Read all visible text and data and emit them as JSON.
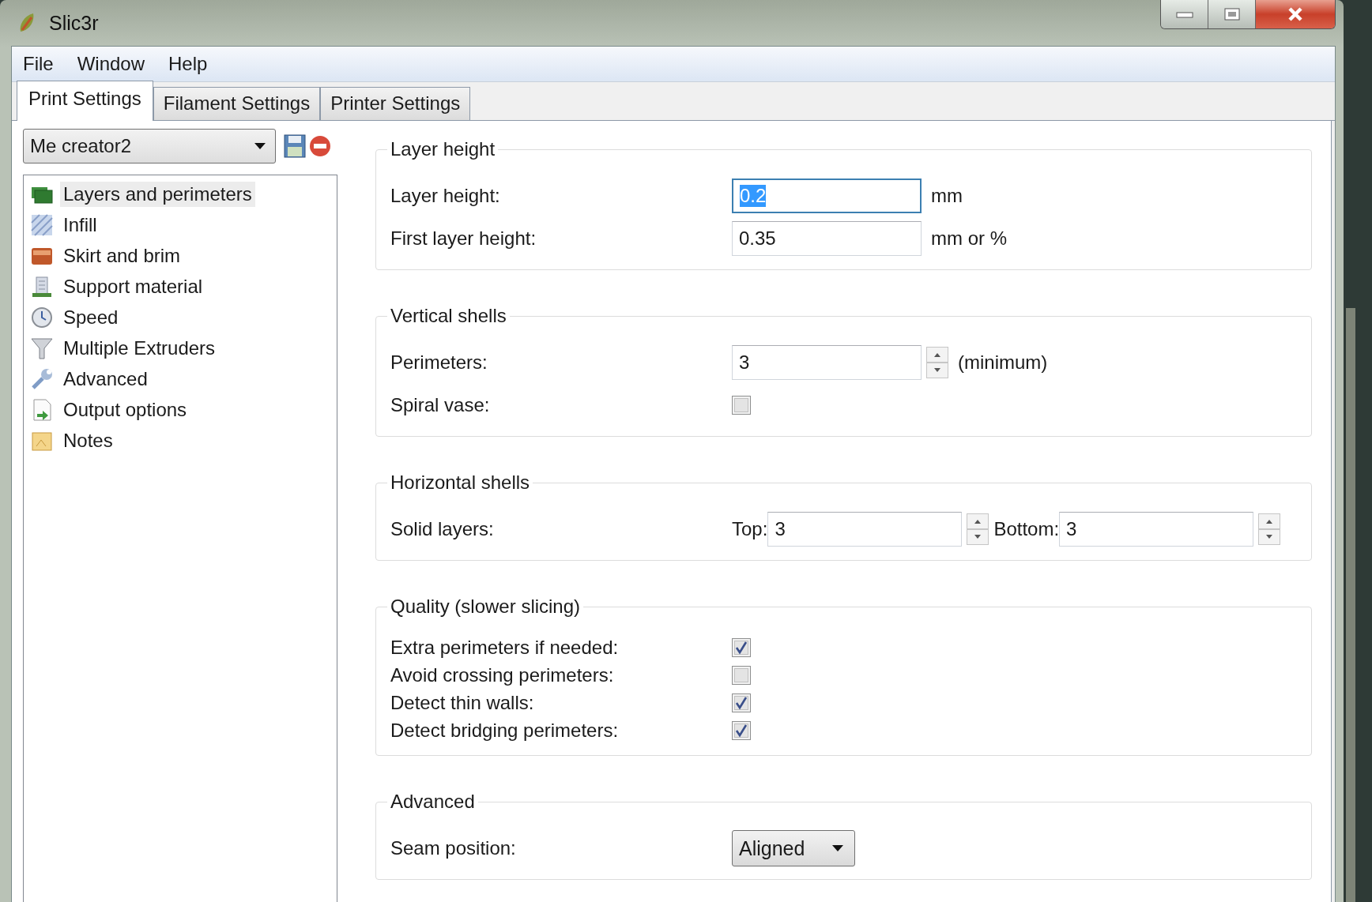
{
  "window": {
    "title": "Slic3r"
  },
  "menu": [
    "File",
    "Window",
    "Help"
  ],
  "tabs": [
    {
      "label": "Print Settings",
      "selected": true
    },
    {
      "label": "Filament Settings",
      "selected": false
    },
    {
      "label": "Printer Settings",
      "selected": false
    }
  ],
  "preset": {
    "value": "Me creator2"
  },
  "sidebar": {
    "items": [
      {
        "label": "Layers and perimeters",
        "selected": true
      },
      {
        "label": "Infill",
        "selected": false
      },
      {
        "label": "Skirt and brim",
        "selected": false
      },
      {
        "label": "Support material",
        "selected": false
      },
      {
        "label": "Speed",
        "selected": false
      },
      {
        "label": "Multiple Extruders",
        "selected": false
      },
      {
        "label": "Advanced",
        "selected": false
      },
      {
        "label": "Output options",
        "selected": false
      },
      {
        "label": "Notes",
        "selected": false
      }
    ]
  },
  "groups": [
    {
      "title": "Layer height",
      "compact": false,
      "rows": [
        {
          "kind": "text",
          "label": "Layer height:",
          "value": "0.2",
          "focused": true,
          "unit": "mm"
        },
        {
          "kind": "text",
          "label": "First layer height:",
          "value": "0.35",
          "focused": false,
          "unit": "mm or %"
        }
      ]
    },
    {
      "title": "Vertical shells",
      "compact": false,
      "rows": [
        {
          "kind": "spin",
          "label": "Perimeters:",
          "value": "3",
          "unit": "(minimum)"
        },
        {
          "kind": "checkbox",
          "label": "Spiral vase:",
          "checked": false
        }
      ]
    },
    {
      "title": "Horizontal shells",
      "compact": false,
      "rows": [
        {
          "kind": "spinpair",
          "label": "Solid layers:",
          "parts": [
            {
              "label": "Top:",
              "value": "3"
            },
            {
              "label": "Bottom:",
              "value": "3"
            }
          ]
        }
      ]
    },
    {
      "title": "Quality (slower slicing)",
      "compact": true,
      "rows": [
        {
          "kind": "checkbox",
          "label": "Extra perimeters if needed:",
          "checked": true
        },
        {
          "kind": "checkbox",
          "label": "Avoid crossing perimeters:",
          "checked": false
        },
        {
          "kind": "checkbox",
          "label": "Detect thin walls:",
          "checked": true
        },
        {
          "kind": "checkbox",
          "label": "Detect bridging perimeters:",
          "checked": true
        }
      ]
    },
    {
      "title": "Advanced",
      "compact": false,
      "rows": [
        {
          "kind": "select",
          "label": "Seam position:",
          "value": "Aligned"
        }
      ]
    }
  ]
}
